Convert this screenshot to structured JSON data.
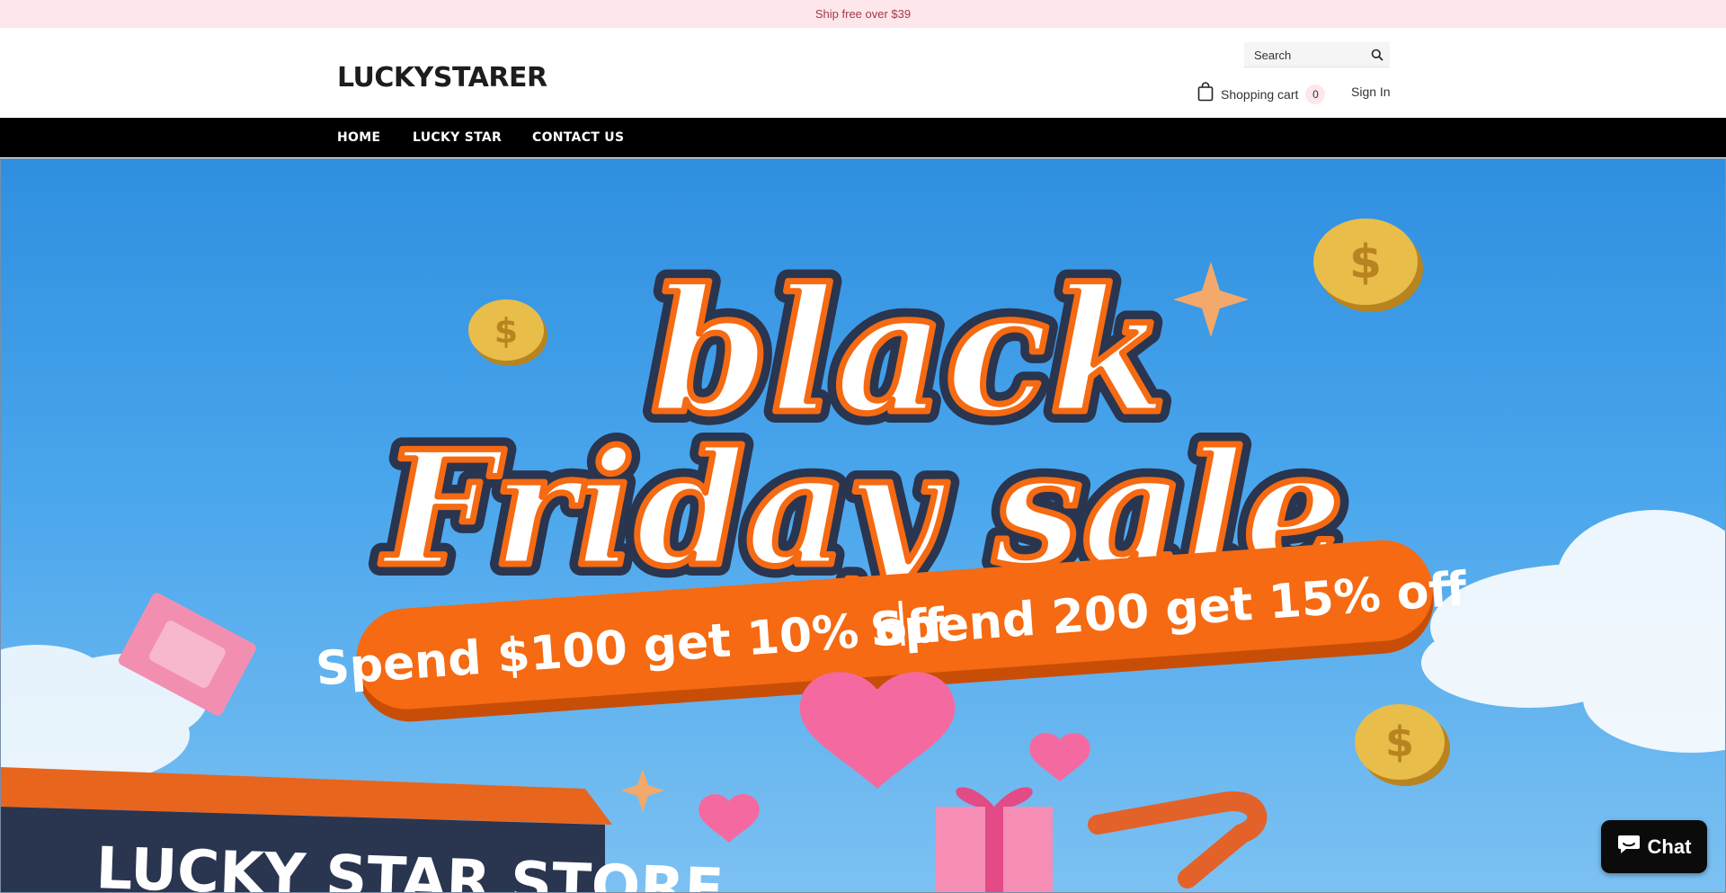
{
  "announcement": {
    "text": "Ship free over $39"
  },
  "header": {
    "logo": "LUCKYSTARER",
    "search": {
      "placeholder": "Search",
      "value": ""
    },
    "cart": {
      "label": "Shopping cart",
      "count": "0"
    },
    "signin": "Sign In"
  },
  "nav": {
    "items": [
      {
        "label": "HOME"
      },
      {
        "label": "LUCKY STAR"
      },
      {
        "label": "CONTACT US"
      }
    ]
  },
  "hero": {
    "headline_line1": "black",
    "headline_line2": "Friday sale",
    "offer_left": "Spend $100 get 10% off",
    "offer_right": "Spend 200 get 15% off",
    "store_sign": "LUCKY STAR STORE",
    "colors": {
      "sky": "#3b9ae6",
      "banner": "#f56a12",
      "outline": "#2a3550",
      "coin": "#e3b43b",
      "pink": "#f46aa0"
    }
  },
  "chat_widget": {
    "label": "Chat"
  },
  "colors": {
    "announce_bg": "#fde7ea",
    "nav_bg": "#000000",
    "accent_badge": "#fde7ea"
  }
}
